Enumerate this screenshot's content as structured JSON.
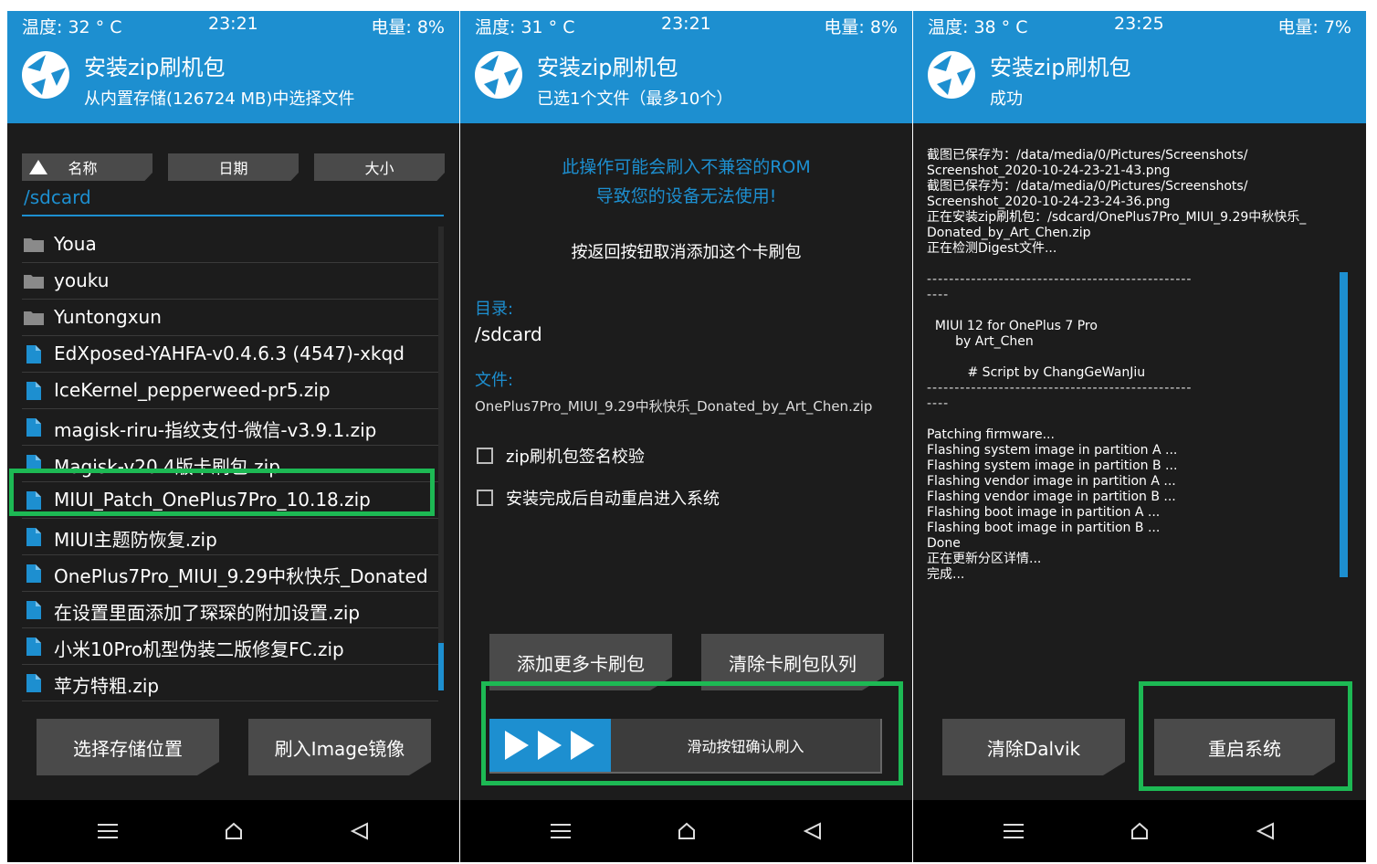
{
  "colors": {
    "accent": "#1d8fd0",
    "panel_bg": "#1c1c1c",
    "button": "#4a4a4a",
    "highlight": "#1db954"
  },
  "panel1": {
    "status": {
      "temp": "温度: 32 ° C",
      "time": "23:21",
      "battery": "电量: 8%"
    },
    "header": {
      "title": "安装zip刷机包",
      "subtitle": "从内置存储(126724 MB)中选择文件"
    },
    "sort": {
      "name": "名称",
      "date": "日期",
      "size": "大小"
    },
    "path": "/sdcard",
    "files": [
      {
        "name": "Youa",
        "type": "folder"
      },
      {
        "name": "youku",
        "type": "folder"
      },
      {
        "name": "Yuntongxun",
        "type": "folder"
      },
      {
        "name": "EdXposed-YAHFA-v0.4.6.3 (4547)-xkqd",
        "type": "file"
      },
      {
        "name": "IceKernel_pepperweed-pr5.zip",
        "type": "file"
      },
      {
        "name": "magisk-riru-指纹支付-微信-v3.9.1.zip",
        "type": "file"
      },
      {
        "name": "Magisk-v20.4版卡刷包.zip",
        "type": "file"
      },
      {
        "name": "MIUI_Patch_OnePlus7Pro_10.18.zip",
        "type": "file"
      },
      {
        "name": "MIUI主题防恢复.zip",
        "type": "file"
      },
      {
        "name": "OnePlus7Pro_MIUI_9.29中秋快乐_Donated",
        "type": "file"
      },
      {
        "name": "在设置里面添加了琛琛的附加设置.zip",
        "type": "file"
      },
      {
        "name": "小米10Pro机型伪装二版修复FC.zip",
        "type": "file"
      },
      {
        "name": "苹方特粗.zip",
        "type": "file"
      }
    ],
    "buttons": {
      "storage": "选择存储位置",
      "image": "刷入Image镜像"
    }
  },
  "panel2": {
    "status": {
      "temp": "温度: 31 ° C",
      "time": "23:21",
      "battery": "电量: 8%"
    },
    "header": {
      "title": "安装zip刷机包",
      "subtitle": "已选1个文件（最多10个）"
    },
    "warning1": "此操作可能会刷入不兼容的ROM",
    "warning2": "导致您的设备无法使用!",
    "cancel_hint": "按返回按钮取消添加这个卡刷包",
    "dir_label": "目录:",
    "dir_value": "/sdcard",
    "file_label": "文件:",
    "file_value": "OnePlus7Pro_MIUI_9.29中秋快乐_Donated_by_Art_Chen.zip",
    "check1": "zip刷机包签名校验",
    "check2": "安装完成后自动重启进入系统",
    "buttons": {
      "add_more": "添加更多卡刷包",
      "clear_queue": "清除卡刷包队列"
    },
    "slider_text": "滑动按钮确认刷入"
  },
  "panel3": {
    "status": {
      "temp": "温度: 38 ° C",
      "time": "23:25",
      "battery": "电量: 7%"
    },
    "header": {
      "title": "安装zip刷机包",
      "subtitle": "成功"
    },
    "log": [
      "截图已保存为：/data/media/0/Pictures/Screenshots/",
      "Screenshot_2020-10-24-23-21-43.png",
      "截图已保存为：/data/media/0/Pictures/Screenshots/",
      "Screenshot_2020-10-24-23-24-36.png",
      "正在安装zip刷机包：/sdcard/OnePlus7Pro_MIUI_9.29中秋快乐_",
      "Donated_by_Art_Chen.zip",
      "正在检测Digest文件...",
      "",
      "------------------------------------------------",
      "----",
      "",
      "  MIUI 12 for OnePlus 7 Pro",
      "       by Art_Chen",
      "",
      "          # Script by ChangGeWanJiu",
      "------------------------------------------------",
      "----",
      "",
      "Patching firmware...",
      "Flashing system image in partition A ...",
      "Flashing system image in partition B ...",
      "Flashing vendor image in partition A ...",
      "Flashing vendor image in partition B ...",
      "Flashing boot image in partition A ...",
      "Flashing boot image in partition B ...",
      "Done",
      "正在更新分区详情...",
      "完成..."
    ],
    "buttons": {
      "dalvik": "清除Dalvik",
      "reboot": "重启系统"
    }
  }
}
